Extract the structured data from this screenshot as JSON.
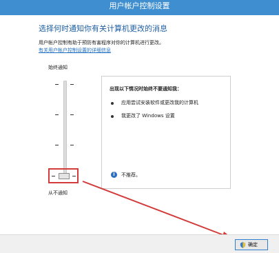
{
  "window": {
    "title": "用户帐户控制设置"
  },
  "main": {
    "heading": "选择何时通知你有关计算机更改的消息",
    "description": "用户帐户控制有助于预防有害程序对你的计算机进行更改。",
    "help_link": "有关用户帐户控制设置的详细信息"
  },
  "slider": {
    "top_label": "始终通知",
    "bottom_label": "从不通知",
    "level_index": 0,
    "level_count": 4
  },
  "info_panel": {
    "title": "出现以下情况时始终不要通知我：",
    "bullets": [
      "应用尝试安装软件或更改我的计算机",
      "我更改了 Windows 设置"
    ],
    "note": "不推荐。"
  },
  "footer": {
    "ok_label": "确定"
  },
  "colors": {
    "title_bar": "#3f8fd0",
    "heading": "#1f5fa5",
    "link": "#1f6fc5",
    "annotation": "#d33a3a"
  },
  "icons": {
    "info": "info-icon",
    "shield": "uac-shield-icon"
  }
}
